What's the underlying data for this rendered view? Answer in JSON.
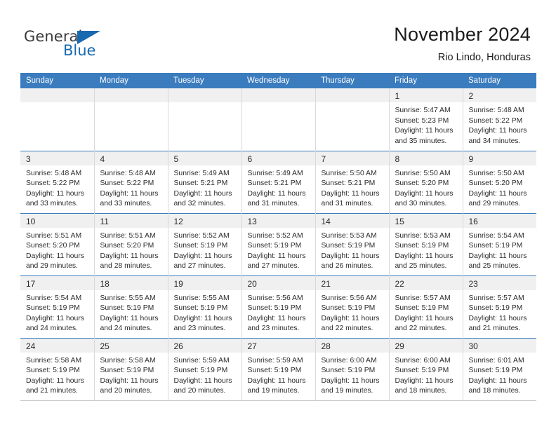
{
  "brand": {
    "name_part1": "General",
    "name_part2": "Blue"
  },
  "header": {
    "title": "November 2024",
    "subtitle": "Rio Lindo, Honduras"
  },
  "weekday_headers": [
    "Sunday",
    "Monday",
    "Tuesday",
    "Wednesday",
    "Thursday",
    "Friday",
    "Saturday"
  ],
  "colors": {
    "header_blue": "#3a7cbe",
    "brand_blue": "#1769b0",
    "daynum_strip": "#f0f0f0",
    "cell_border": "#d9d9d9"
  },
  "weeks": [
    [
      {
        "empty": true
      },
      {
        "empty": true
      },
      {
        "empty": true
      },
      {
        "empty": true
      },
      {
        "empty": true
      },
      {
        "day": "1",
        "sunrise": "Sunrise: 5:47 AM",
        "sunset": "Sunset: 5:23 PM",
        "daylight1": "Daylight: 11 hours",
        "daylight2": "and 35 minutes."
      },
      {
        "day": "2",
        "sunrise": "Sunrise: 5:48 AM",
        "sunset": "Sunset: 5:22 PM",
        "daylight1": "Daylight: 11 hours",
        "daylight2": "and 34 minutes."
      }
    ],
    [
      {
        "day": "3",
        "sunrise": "Sunrise: 5:48 AM",
        "sunset": "Sunset: 5:22 PM",
        "daylight1": "Daylight: 11 hours",
        "daylight2": "and 33 minutes."
      },
      {
        "day": "4",
        "sunrise": "Sunrise: 5:48 AM",
        "sunset": "Sunset: 5:22 PM",
        "daylight1": "Daylight: 11 hours",
        "daylight2": "and 33 minutes."
      },
      {
        "day": "5",
        "sunrise": "Sunrise: 5:49 AM",
        "sunset": "Sunset: 5:21 PM",
        "daylight1": "Daylight: 11 hours",
        "daylight2": "and 32 minutes."
      },
      {
        "day": "6",
        "sunrise": "Sunrise: 5:49 AM",
        "sunset": "Sunset: 5:21 PM",
        "daylight1": "Daylight: 11 hours",
        "daylight2": "and 31 minutes."
      },
      {
        "day": "7",
        "sunrise": "Sunrise: 5:50 AM",
        "sunset": "Sunset: 5:21 PM",
        "daylight1": "Daylight: 11 hours",
        "daylight2": "and 31 minutes."
      },
      {
        "day": "8",
        "sunrise": "Sunrise: 5:50 AM",
        "sunset": "Sunset: 5:20 PM",
        "daylight1": "Daylight: 11 hours",
        "daylight2": "and 30 minutes."
      },
      {
        "day": "9",
        "sunrise": "Sunrise: 5:50 AM",
        "sunset": "Sunset: 5:20 PM",
        "daylight1": "Daylight: 11 hours",
        "daylight2": "and 29 minutes."
      }
    ],
    [
      {
        "day": "10",
        "sunrise": "Sunrise: 5:51 AM",
        "sunset": "Sunset: 5:20 PM",
        "daylight1": "Daylight: 11 hours",
        "daylight2": "and 29 minutes."
      },
      {
        "day": "11",
        "sunrise": "Sunrise: 5:51 AM",
        "sunset": "Sunset: 5:20 PM",
        "daylight1": "Daylight: 11 hours",
        "daylight2": "and 28 minutes."
      },
      {
        "day": "12",
        "sunrise": "Sunrise: 5:52 AM",
        "sunset": "Sunset: 5:19 PM",
        "daylight1": "Daylight: 11 hours",
        "daylight2": "and 27 minutes."
      },
      {
        "day": "13",
        "sunrise": "Sunrise: 5:52 AM",
        "sunset": "Sunset: 5:19 PM",
        "daylight1": "Daylight: 11 hours",
        "daylight2": "and 27 minutes."
      },
      {
        "day": "14",
        "sunrise": "Sunrise: 5:53 AM",
        "sunset": "Sunset: 5:19 PM",
        "daylight1": "Daylight: 11 hours",
        "daylight2": "and 26 minutes."
      },
      {
        "day": "15",
        "sunrise": "Sunrise: 5:53 AM",
        "sunset": "Sunset: 5:19 PM",
        "daylight1": "Daylight: 11 hours",
        "daylight2": "and 25 minutes."
      },
      {
        "day": "16",
        "sunrise": "Sunrise: 5:54 AM",
        "sunset": "Sunset: 5:19 PM",
        "daylight1": "Daylight: 11 hours",
        "daylight2": "and 25 minutes."
      }
    ],
    [
      {
        "day": "17",
        "sunrise": "Sunrise: 5:54 AM",
        "sunset": "Sunset: 5:19 PM",
        "daylight1": "Daylight: 11 hours",
        "daylight2": "and 24 minutes."
      },
      {
        "day": "18",
        "sunrise": "Sunrise: 5:55 AM",
        "sunset": "Sunset: 5:19 PM",
        "daylight1": "Daylight: 11 hours",
        "daylight2": "and 24 minutes."
      },
      {
        "day": "19",
        "sunrise": "Sunrise: 5:55 AM",
        "sunset": "Sunset: 5:19 PM",
        "daylight1": "Daylight: 11 hours",
        "daylight2": "and 23 minutes."
      },
      {
        "day": "20",
        "sunrise": "Sunrise: 5:56 AM",
        "sunset": "Sunset: 5:19 PM",
        "daylight1": "Daylight: 11 hours",
        "daylight2": "and 23 minutes."
      },
      {
        "day": "21",
        "sunrise": "Sunrise: 5:56 AM",
        "sunset": "Sunset: 5:19 PM",
        "daylight1": "Daylight: 11 hours",
        "daylight2": "and 22 minutes."
      },
      {
        "day": "22",
        "sunrise": "Sunrise: 5:57 AM",
        "sunset": "Sunset: 5:19 PM",
        "daylight1": "Daylight: 11 hours",
        "daylight2": "and 22 minutes."
      },
      {
        "day": "23",
        "sunrise": "Sunrise: 5:57 AM",
        "sunset": "Sunset: 5:19 PM",
        "daylight1": "Daylight: 11 hours",
        "daylight2": "and 21 minutes."
      }
    ],
    [
      {
        "day": "24",
        "sunrise": "Sunrise: 5:58 AM",
        "sunset": "Sunset: 5:19 PM",
        "daylight1": "Daylight: 11 hours",
        "daylight2": "and 21 minutes."
      },
      {
        "day": "25",
        "sunrise": "Sunrise: 5:58 AM",
        "sunset": "Sunset: 5:19 PM",
        "daylight1": "Daylight: 11 hours",
        "daylight2": "and 20 minutes."
      },
      {
        "day": "26",
        "sunrise": "Sunrise: 5:59 AM",
        "sunset": "Sunset: 5:19 PM",
        "daylight1": "Daylight: 11 hours",
        "daylight2": "and 20 minutes."
      },
      {
        "day": "27",
        "sunrise": "Sunrise: 5:59 AM",
        "sunset": "Sunset: 5:19 PM",
        "daylight1": "Daylight: 11 hours",
        "daylight2": "and 19 minutes."
      },
      {
        "day": "28",
        "sunrise": "Sunrise: 6:00 AM",
        "sunset": "Sunset: 5:19 PM",
        "daylight1": "Daylight: 11 hours",
        "daylight2": "and 19 minutes."
      },
      {
        "day": "29",
        "sunrise": "Sunrise: 6:00 AM",
        "sunset": "Sunset: 5:19 PM",
        "daylight1": "Daylight: 11 hours",
        "daylight2": "and 18 minutes."
      },
      {
        "day": "30",
        "sunrise": "Sunrise: 6:01 AM",
        "sunset": "Sunset: 5:19 PM",
        "daylight1": "Daylight: 11 hours",
        "daylight2": "and 18 minutes."
      }
    ]
  ]
}
